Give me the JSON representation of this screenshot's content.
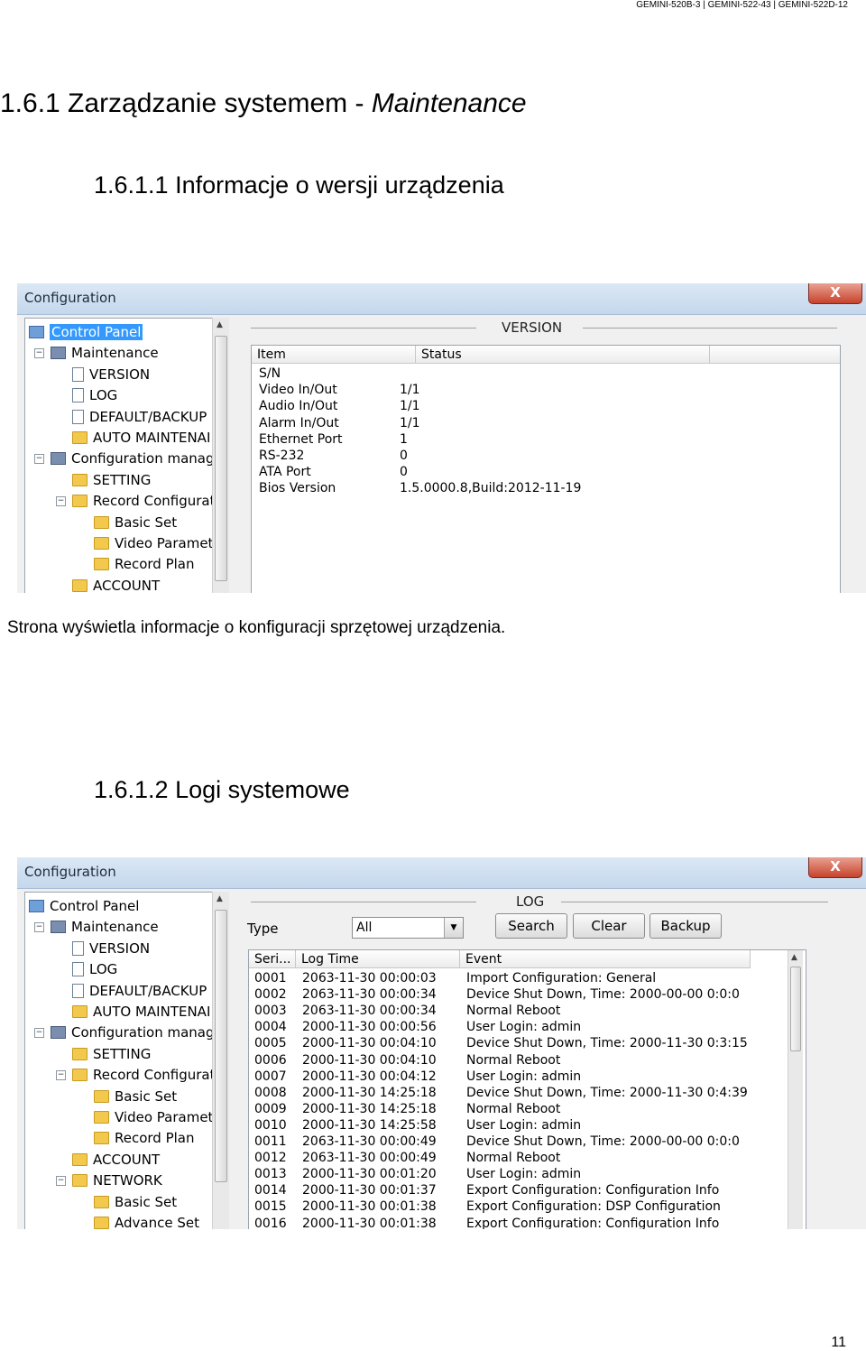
{
  "header_right": "GEMINI-520B-3 | GEMINI-522-43 | GEMINI-522D-12",
  "heading1": {
    "prefix": "1.6.1 Zarządzanie systemem - ",
    "italic": "Maintenance"
  },
  "heading2a": "1.6.1.1 Informacje o wersji urządzenia",
  "paragraph": "Strona wyświetla informacje o konfiguracji sprzętowej urządzenia.",
  "heading2b": "1.6.1.2 Logi systemowe",
  "page_number": "11",
  "dialog1": {
    "title": "Configuration",
    "close_label": "X",
    "tree": [
      "Control Panel",
      "Maintenance",
      "VERSION",
      "LOG",
      "DEFAULT/BACKUP",
      "AUTO MAINTENAI",
      "Configuration manage",
      "SETTING",
      "Record Configurat",
      "Basic Set",
      "Video Paramet",
      "Record Plan",
      "ACCOUNT"
    ],
    "panel_title": "VERSION",
    "columns": [
      "Item",
      "Status"
    ],
    "rows": [
      [
        "S/N",
        ""
      ],
      [
        "Video In/Out",
        "1/1"
      ],
      [
        "Audio In/Out",
        "1/1"
      ],
      [
        "Alarm In/Out",
        "1/1"
      ],
      [
        "Ethernet Port",
        "1"
      ],
      [
        "RS-232",
        "0"
      ],
      [
        "ATA Port",
        "0"
      ],
      [
        "Bios Version",
        "1.5.0000.8,Build:2012-11-19"
      ]
    ]
  },
  "dialog2": {
    "title": "Configuration",
    "close_label": "X",
    "tree": [
      "Control Panel",
      "Maintenance",
      "VERSION",
      "LOG",
      "DEFAULT/BACKUP",
      "AUTO MAINTENAI",
      "Configuration manage",
      "SETTING",
      "Record Configurat",
      "Basic Set",
      "Video Paramet",
      "Record Plan",
      "ACCOUNT",
      "NETWORK",
      "Basic Set",
      "Advance Set"
    ],
    "panel_title": "LOG",
    "type_label": "Type",
    "type_value": "All",
    "buttons": [
      "Search",
      "Clear",
      "Backup"
    ],
    "columns": [
      "Seri...",
      "Log Time",
      "Event"
    ],
    "rows": [
      [
        "0001",
        "2063-11-30 00:00:03",
        "Import Configuration: General"
      ],
      [
        "0002",
        "2063-11-30 00:00:34",
        "Device Shut Down, Time: 2000-00-00 0:0:0"
      ],
      [
        "0003",
        "2063-11-30 00:00:34",
        "Normal Reboot"
      ],
      [
        "0004",
        "2000-11-30 00:00:56",
        "User Login: admin"
      ],
      [
        "0005",
        "2000-11-30 00:04:10",
        "Device Shut Down, Time: 2000-11-30 0:3:15"
      ],
      [
        "0006",
        "2000-11-30 00:04:10",
        "Normal Reboot"
      ],
      [
        "0007",
        "2000-11-30 00:04:12",
        "User Login: admin"
      ],
      [
        "0008",
        "2000-11-30 14:25:18",
        "Device Shut Down, Time: 2000-11-30 0:4:39"
      ],
      [
        "0009",
        "2000-11-30 14:25:18",
        "Normal Reboot"
      ],
      [
        "0010",
        "2000-11-30 14:25:58",
        "User Login: admin"
      ],
      [
        "0011",
        "2063-11-30 00:00:49",
        "Device Shut Down, Time: 2000-00-00 0:0:0"
      ],
      [
        "0012",
        "2063-11-30 00:00:49",
        "Normal Reboot"
      ],
      [
        "0013",
        "2000-11-30 00:01:20",
        "User Login: admin"
      ],
      [
        "0014",
        "2000-11-30 00:01:37",
        "Export Configuration: Configuration Info"
      ],
      [
        "0015",
        "2000-11-30 00:01:38",
        "Export Configuration: DSP Configuration"
      ],
      [
        "0016",
        "2000-11-30 00:01:38",
        "Export Configuration: Configuration Info"
      ]
    ]
  }
}
